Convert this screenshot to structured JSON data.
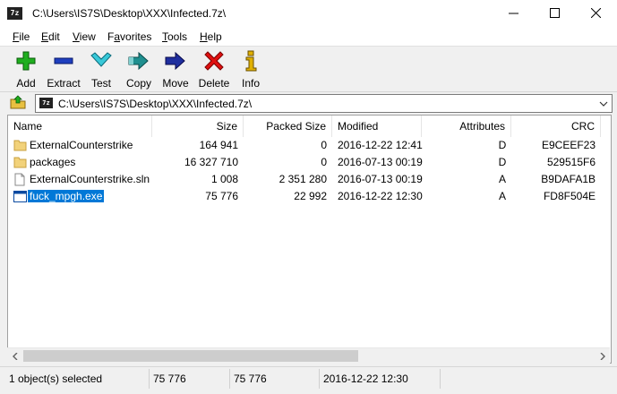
{
  "window": {
    "app_icon_text": "7z",
    "title": "C:\\Users\\IS7S\\Desktop\\XXX\\Infected.7z\\",
    "minimize_icon": "minimize-icon",
    "maximize_icon": "maximize-icon",
    "close_icon": "close-icon"
  },
  "menu": [
    {
      "label": "File",
      "hotkey": "F",
      "rest": "ile"
    },
    {
      "label": "Edit",
      "hotkey": "E",
      "rest": "dit"
    },
    {
      "label": "View",
      "hotkey": "V",
      "rest": "iew"
    },
    {
      "label": "Favorites",
      "hotkey": "a",
      "pre": "F",
      "rest": "vorites"
    },
    {
      "label": "Tools",
      "hotkey": "T",
      "rest": "ools"
    },
    {
      "label": "Help",
      "hotkey": "H",
      "rest": "elp"
    }
  ],
  "toolbar": {
    "add": "Add",
    "extract": "Extract",
    "test": "Test",
    "copy": "Copy",
    "move": "Move",
    "delete": "Delete",
    "info": "Info",
    "colors": {
      "add": "#1fae1f",
      "extract": "#1f3fbf",
      "test": "#38c8d8",
      "copy": "#1f8f8f",
      "move": "#1f2f9f",
      "delete": "#e01010",
      "info": "#e0b000"
    }
  },
  "address": {
    "icon_text": "7z",
    "path": "C:\\Users\\IS7S\\Desktop\\XXX\\Infected.7z\\"
  },
  "columns": {
    "name": "Name",
    "size": "Size",
    "packed": "Packed Size",
    "modified": "Modified",
    "attributes": "Attributes",
    "crc": "CRC"
  },
  "rows": [
    {
      "name": "ExternalCounterstrike",
      "type": "folder",
      "size": "164 941",
      "packed": "0",
      "modified": "2016-12-22 12:41",
      "attr": "D",
      "crc": "E9CEEF23"
    },
    {
      "name": "packages",
      "type": "folder",
      "size": "16 327 710",
      "packed": "0",
      "modified": "2016-07-13 00:19",
      "attr": "D",
      "crc": "529515F6"
    },
    {
      "name": "ExternalCounterstrike.sln",
      "type": "file",
      "size": "1 008",
      "packed": "2 351 280",
      "modified": "2016-07-13 00:19",
      "attr": "A",
      "crc": "B9DAFA1B"
    },
    {
      "name": "fuck_mpgh.exe",
      "type": "exe",
      "size": "75 776",
      "packed": "22 992",
      "modified": "2016-12-22 12:30",
      "attr": "A",
      "crc": "FD8F504E",
      "selected": true
    }
  ],
  "status": {
    "selected": "1 object(s) selected",
    "size": "75 776",
    "packed": "75 776",
    "modified": "2016-12-22 12:30"
  }
}
